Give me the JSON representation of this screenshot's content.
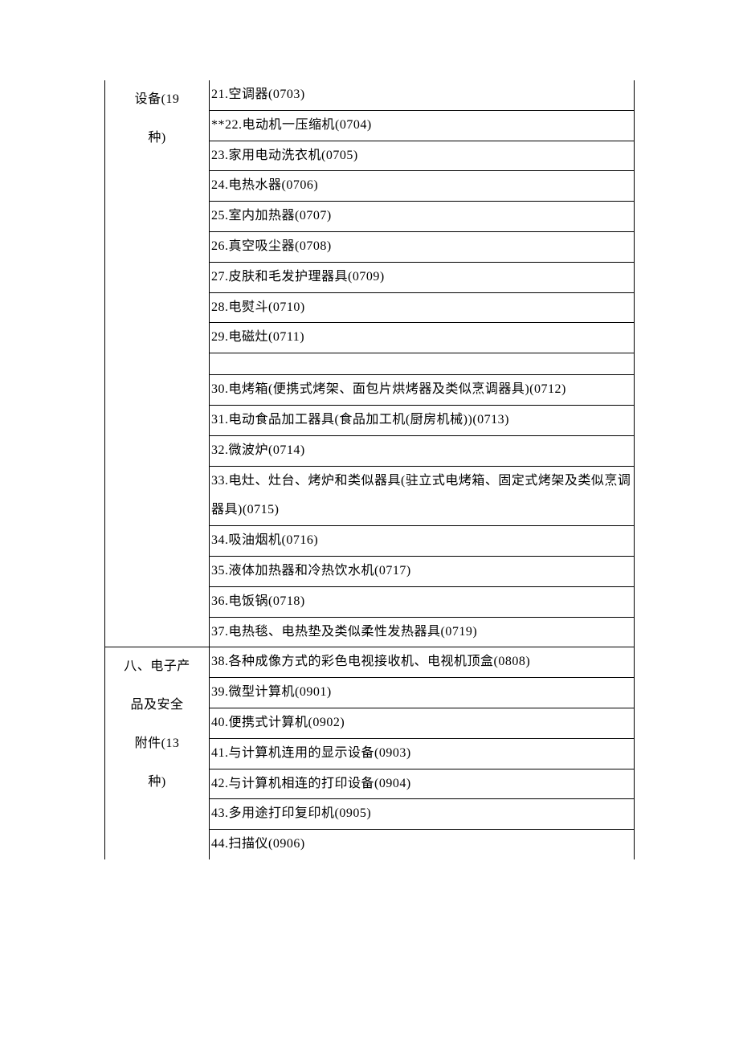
{
  "sections": [
    {
      "category_lines": [
        "设备(19",
        "种)"
      ],
      "rows": [
        {
          "text": "21.空调器(0703)",
          "no_top": true
        },
        {
          "text": "**22.电动机一压缩机(0704)"
        },
        {
          "text": "23.家用电动洗衣机(0705)"
        },
        {
          "text": "24.电热水器(0706)"
        },
        {
          "text": "25.室内加热器(0707)"
        },
        {
          "text": "26.真空吸尘器(0708)"
        },
        {
          "text": "27.皮肤和毛发护理器具(0709)"
        },
        {
          "text": "28.电熨斗(0710)"
        },
        {
          "text": "29.电磁灶(0711)"
        },
        {
          "spacer": true
        },
        {
          "text": "30.电烤箱(便携式烤架、面包片烘烤器及类似烹调器具)(0712)"
        },
        {
          "text": "31.电动食品加工器具(食品加工机(厨房机械))(0713)"
        },
        {
          "text": "32.微波炉(0714)"
        },
        {
          "text": "33.电灶、灶台、烤炉和类似器具(驻立式电烤箱、固定式烤架及类似烹调器具)(0715)"
        },
        {
          "text": "34.吸油烟机(0716)"
        },
        {
          "text": "35.液体加热器和冷热饮水机(0717)"
        },
        {
          "text": "36.电饭锅(0718)"
        },
        {
          "text": "37.电热毯、电热垫及类似柔性发热器具(0719)"
        }
      ]
    },
    {
      "category_lines": [
        "八、电子产",
        "品及安全",
        "附件(13",
        "种)"
      ],
      "rows": [
        {
          "text": "38.各种成像方式的彩色电视接收机、电视机顶盒(0808)"
        },
        {
          "text": "39.微型计算机(0901)"
        },
        {
          "text": "40.便携式计算机(0902)"
        },
        {
          "text": "41.与计算机连用的显示设备(0903)"
        },
        {
          "text": "42.与计算机相连的打印设备(0904)"
        },
        {
          "text": "43.多用途打印复印机(0905)"
        },
        {
          "text": "44.扫描仪(0906)",
          "no_bottom": true
        }
      ]
    }
  ]
}
